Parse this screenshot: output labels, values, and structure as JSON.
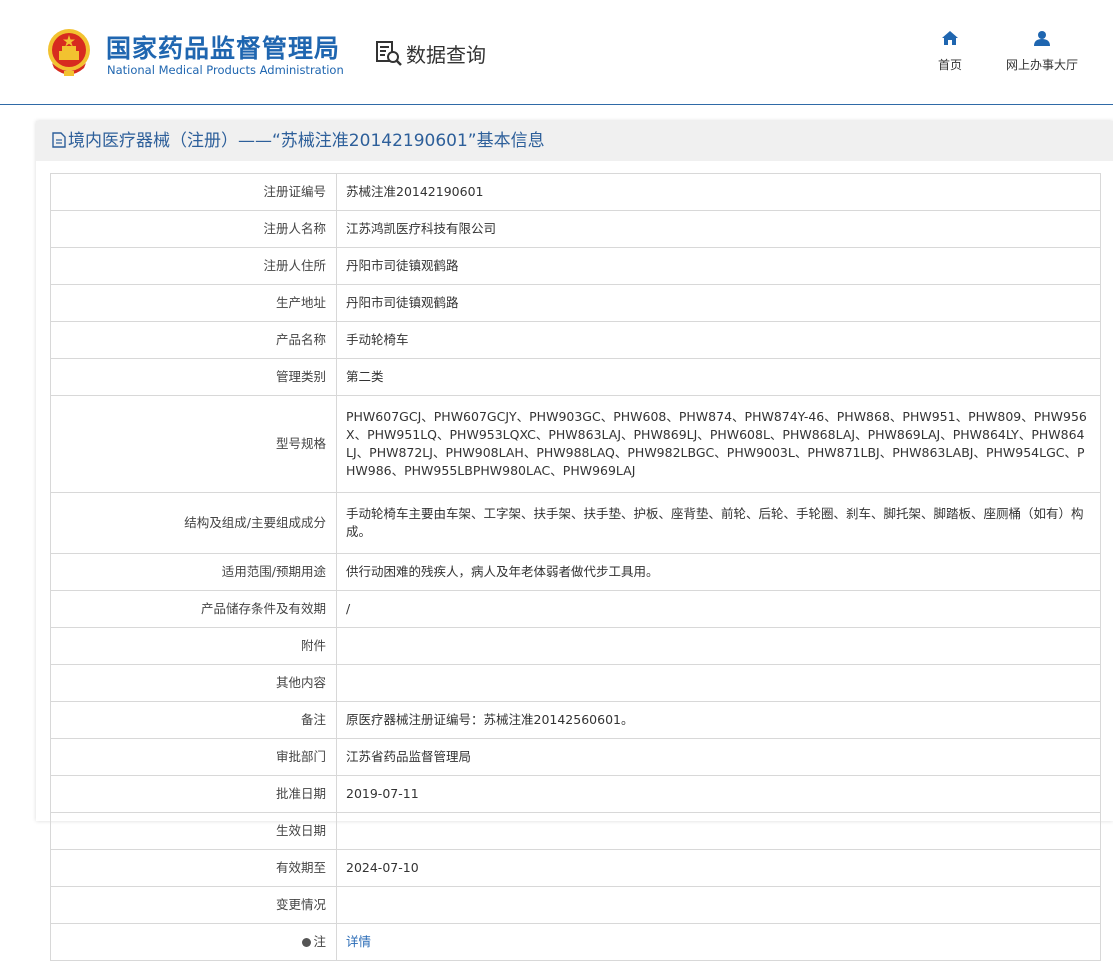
{
  "header": {
    "brand_cn": "国家药品监督管理局",
    "brand_en": "National Medical Products Administration",
    "query_title": "数据查询",
    "nav": [
      {
        "label": "首页",
        "icon": "home-icon"
      },
      {
        "label": "网上办事大厅",
        "icon": "user-icon"
      }
    ]
  },
  "panel": {
    "title": "境内医疗器械（注册）——“苏械注准20142190601”基本信息"
  },
  "rows": [
    {
      "label": "注册证编号",
      "value": "苏械注准20142190601"
    },
    {
      "label": "注册人名称",
      "value": "江苏鸿凯医疗科技有限公司"
    },
    {
      "label": "注册人住所",
      "value": "丹阳市司徒镇观鹤路"
    },
    {
      "label": "生产地址",
      "value": "丹阳市司徒镇观鹤路"
    },
    {
      "label": "产品名称",
      "value": "手动轮椅车"
    },
    {
      "label": "管理类别",
      "value": "第二类"
    },
    {
      "label": "型号规格",
      "value": "PHW607GCJ、PHW607GCJY、PHW903GC、PHW608、PHW874、PHW874Y-46、PHW868、PHW951、PHW809、PHW956X、PHW951LQ、PHW953LQXC、PHW863LAJ、PHW869LJ、PHW608L、PHW868LAJ、PHW869LAJ、PHW864LY、PHW864LJ、PHW872LJ、PHW908LAH、PHW988LAQ、PHW982LBGC、PHW9003L、PHW871LBJ、PHW863LABJ、PHW954LGC、PHW986、PHW955LBPHW980LAC、PHW969LAJ"
    },
    {
      "label": "结构及组成/主要组成成分",
      "value": "手动轮椅车主要由车架、工字架、扶手架、扶手垫、护板、座背垫、前轮、后轮、手轮圈、刹车、脚托架、脚踏板、座厕桶（如有）构成。"
    },
    {
      "label": "适用范围/预期用途",
      "value": "供行动困难的残疾人，病人及年老体弱者做代步工具用。"
    },
    {
      "label": "产品储存条件及有效期",
      "value": "/"
    },
    {
      "label": "附件",
      "value": ""
    },
    {
      "label": "其他内容",
      "value": ""
    },
    {
      "label": "备注",
      "value": "原医疗器械注册证编号：苏械注准20142560601。"
    },
    {
      "label": "审批部门",
      "value": "江苏省药品监督管理局"
    },
    {
      "label": "批准日期",
      "value": "2019-07-11"
    },
    {
      "label": "生效日期",
      "value": ""
    },
    {
      "label": "有效期至",
      "value": "2024-07-10"
    },
    {
      "label": "变更情况",
      "value": ""
    },
    {
      "label": "注",
      "value": "详情"
    }
  ],
  "colors": {
    "brand": "#1f66b0",
    "link": "#2a6bb6",
    "title": "#2d5f9a"
  }
}
